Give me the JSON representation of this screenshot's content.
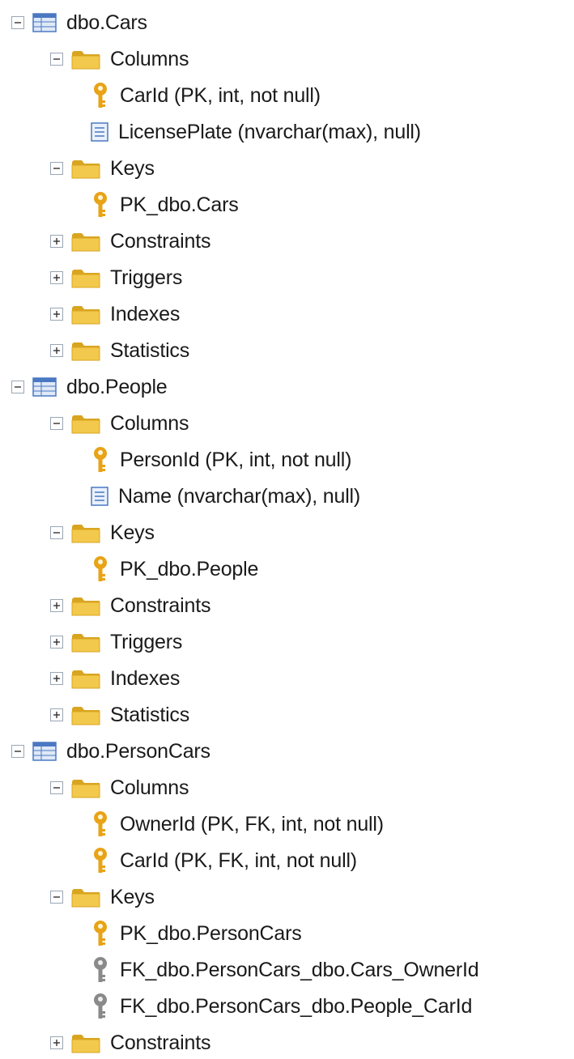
{
  "tree": [
    {
      "level": 0,
      "expander": "minus",
      "icon": "table-icon",
      "label": "dbo.Cars"
    },
    {
      "level": 1,
      "expander": "minus",
      "icon": "folder-icon",
      "label": "Columns"
    },
    {
      "level": 2,
      "expander": "none",
      "icon": "primary-key-icon",
      "label": "CarId (PK, int, not null)"
    },
    {
      "level": 2,
      "expander": "none",
      "icon": "column-icon",
      "label": "LicensePlate (nvarchar(max), null)"
    },
    {
      "level": 1,
      "expander": "minus",
      "icon": "folder-icon",
      "label": "Keys"
    },
    {
      "level": 2,
      "expander": "none",
      "icon": "primary-key-icon",
      "label": "PK_dbo.Cars"
    },
    {
      "level": 1,
      "expander": "plus",
      "icon": "folder-icon",
      "label": "Constraints"
    },
    {
      "level": 1,
      "expander": "plus",
      "icon": "folder-icon",
      "label": "Triggers"
    },
    {
      "level": 1,
      "expander": "plus",
      "icon": "folder-icon",
      "label": "Indexes"
    },
    {
      "level": 1,
      "expander": "plus",
      "icon": "folder-icon",
      "label": "Statistics"
    },
    {
      "level": 0,
      "expander": "minus",
      "icon": "table-icon",
      "label": "dbo.People"
    },
    {
      "level": 1,
      "expander": "minus",
      "icon": "folder-icon",
      "label": "Columns"
    },
    {
      "level": 2,
      "expander": "none",
      "icon": "primary-key-icon",
      "label": "PersonId (PK, int, not null)"
    },
    {
      "level": 2,
      "expander": "none",
      "icon": "column-icon",
      "label": "Name (nvarchar(max), null)"
    },
    {
      "level": 1,
      "expander": "minus",
      "icon": "folder-icon",
      "label": "Keys"
    },
    {
      "level": 2,
      "expander": "none",
      "icon": "primary-key-icon",
      "label": "PK_dbo.People"
    },
    {
      "level": 1,
      "expander": "plus",
      "icon": "folder-icon",
      "label": "Constraints"
    },
    {
      "level": 1,
      "expander": "plus",
      "icon": "folder-icon",
      "label": "Triggers"
    },
    {
      "level": 1,
      "expander": "plus",
      "icon": "folder-icon",
      "label": "Indexes"
    },
    {
      "level": 1,
      "expander": "plus",
      "icon": "folder-icon",
      "label": "Statistics"
    },
    {
      "level": 0,
      "expander": "minus",
      "icon": "table-icon",
      "label": "dbo.PersonCars"
    },
    {
      "level": 1,
      "expander": "minus",
      "icon": "folder-icon",
      "label": "Columns"
    },
    {
      "level": 2,
      "expander": "none",
      "icon": "primary-key-icon",
      "label": "OwnerId (PK, FK, int, not null)"
    },
    {
      "level": 2,
      "expander": "none",
      "icon": "primary-key-icon",
      "label": "CarId (PK, FK, int, not null)"
    },
    {
      "level": 1,
      "expander": "minus",
      "icon": "folder-icon",
      "label": "Keys"
    },
    {
      "level": 2,
      "expander": "none",
      "icon": "primary-key-icon",
      "label": "PK_dbo.PersonCars"
    },
    {
      "level": 2,
      "expander": "none",
      "icon": "foreign-key-icon",
      "label": "FK_dbo.PersonCars_dbo.Cars_OwnerId"
    },
    {
      "level": 2,
      "expander": "none",
      "icon": "foreign-key-icon",
      "label": "FK_dbo.PersonCars_dbo.People_CarId"
    },
    {
      "level": 1,
      "expander": "plus",
      "icon": "folder-icon",
      "label": "Constraints"
    }
  ],
  "colors": {
    "folder": "#f2c94c",
    "folder_dark": "#d9a520",
    "key_gold": "#e8a317",
    "key_gray": "#8a8a8a",
    "table_blue": "#4a78c2",
    "expander_border": "#9aa7b4"
  }
}
